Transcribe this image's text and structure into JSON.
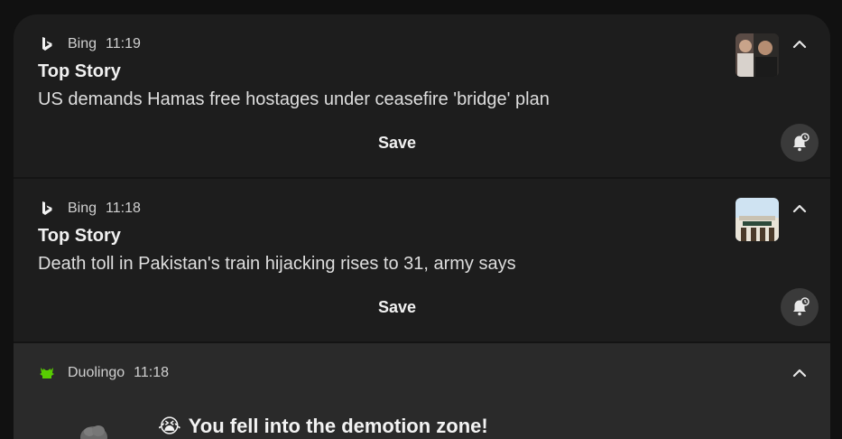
{
  "notifications": [
    {
      "app": "Bing",
      "time": "11:19",
      "title": "Top Story",
      "body": "US demands Hamas free hostages under ceasefire 'bridge' plan",
      "action": "Save",
      "thumbnail": "news-photo-people"
    },
    {
      "app": "Bing",
      "time": "11:18",
      "title": "Top Story",
      "body": "Death toll in Pakistan's train hijacking rises to 31, army says",
      "action": "Save",
      "thumbnail": "news-photo-train-station"
    },
    {
      "app": "Duolingo",
      "time": "11:18",
      "emoji": "😭",
      "title": "You fell into the demotion zone!"
    }
  ],
  "colors": {
    "card": "#1d1d1d",
    "card_highlight": "#2a2a2a",
    "duolingo_green": "#58cc02"
  }
}
